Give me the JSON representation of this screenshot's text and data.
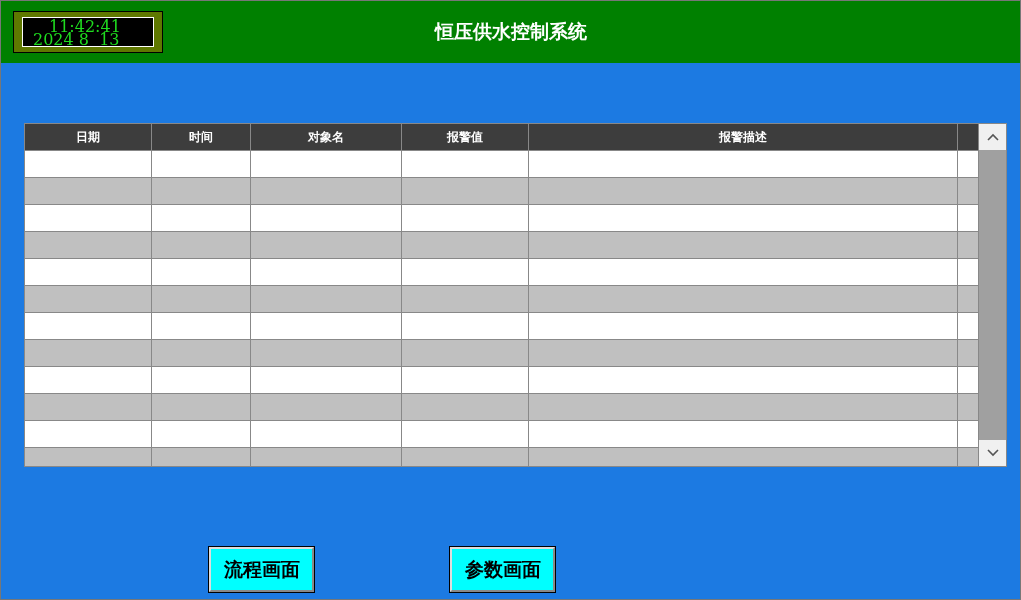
{
  "clock": {
    "time": "11:42:41",
    "date": "2024 8  13"
  },
  "window": {
    "title": "恒压供水控制系统"
  },
  "table": {
    "columns": [
      "日期",
      "时间",
      "对象名",
      "报警值",
      "报警描述",
      ""
    ]
  },
  "buttons": [
    "流程画面",
    "参数画面"
  ]
}
